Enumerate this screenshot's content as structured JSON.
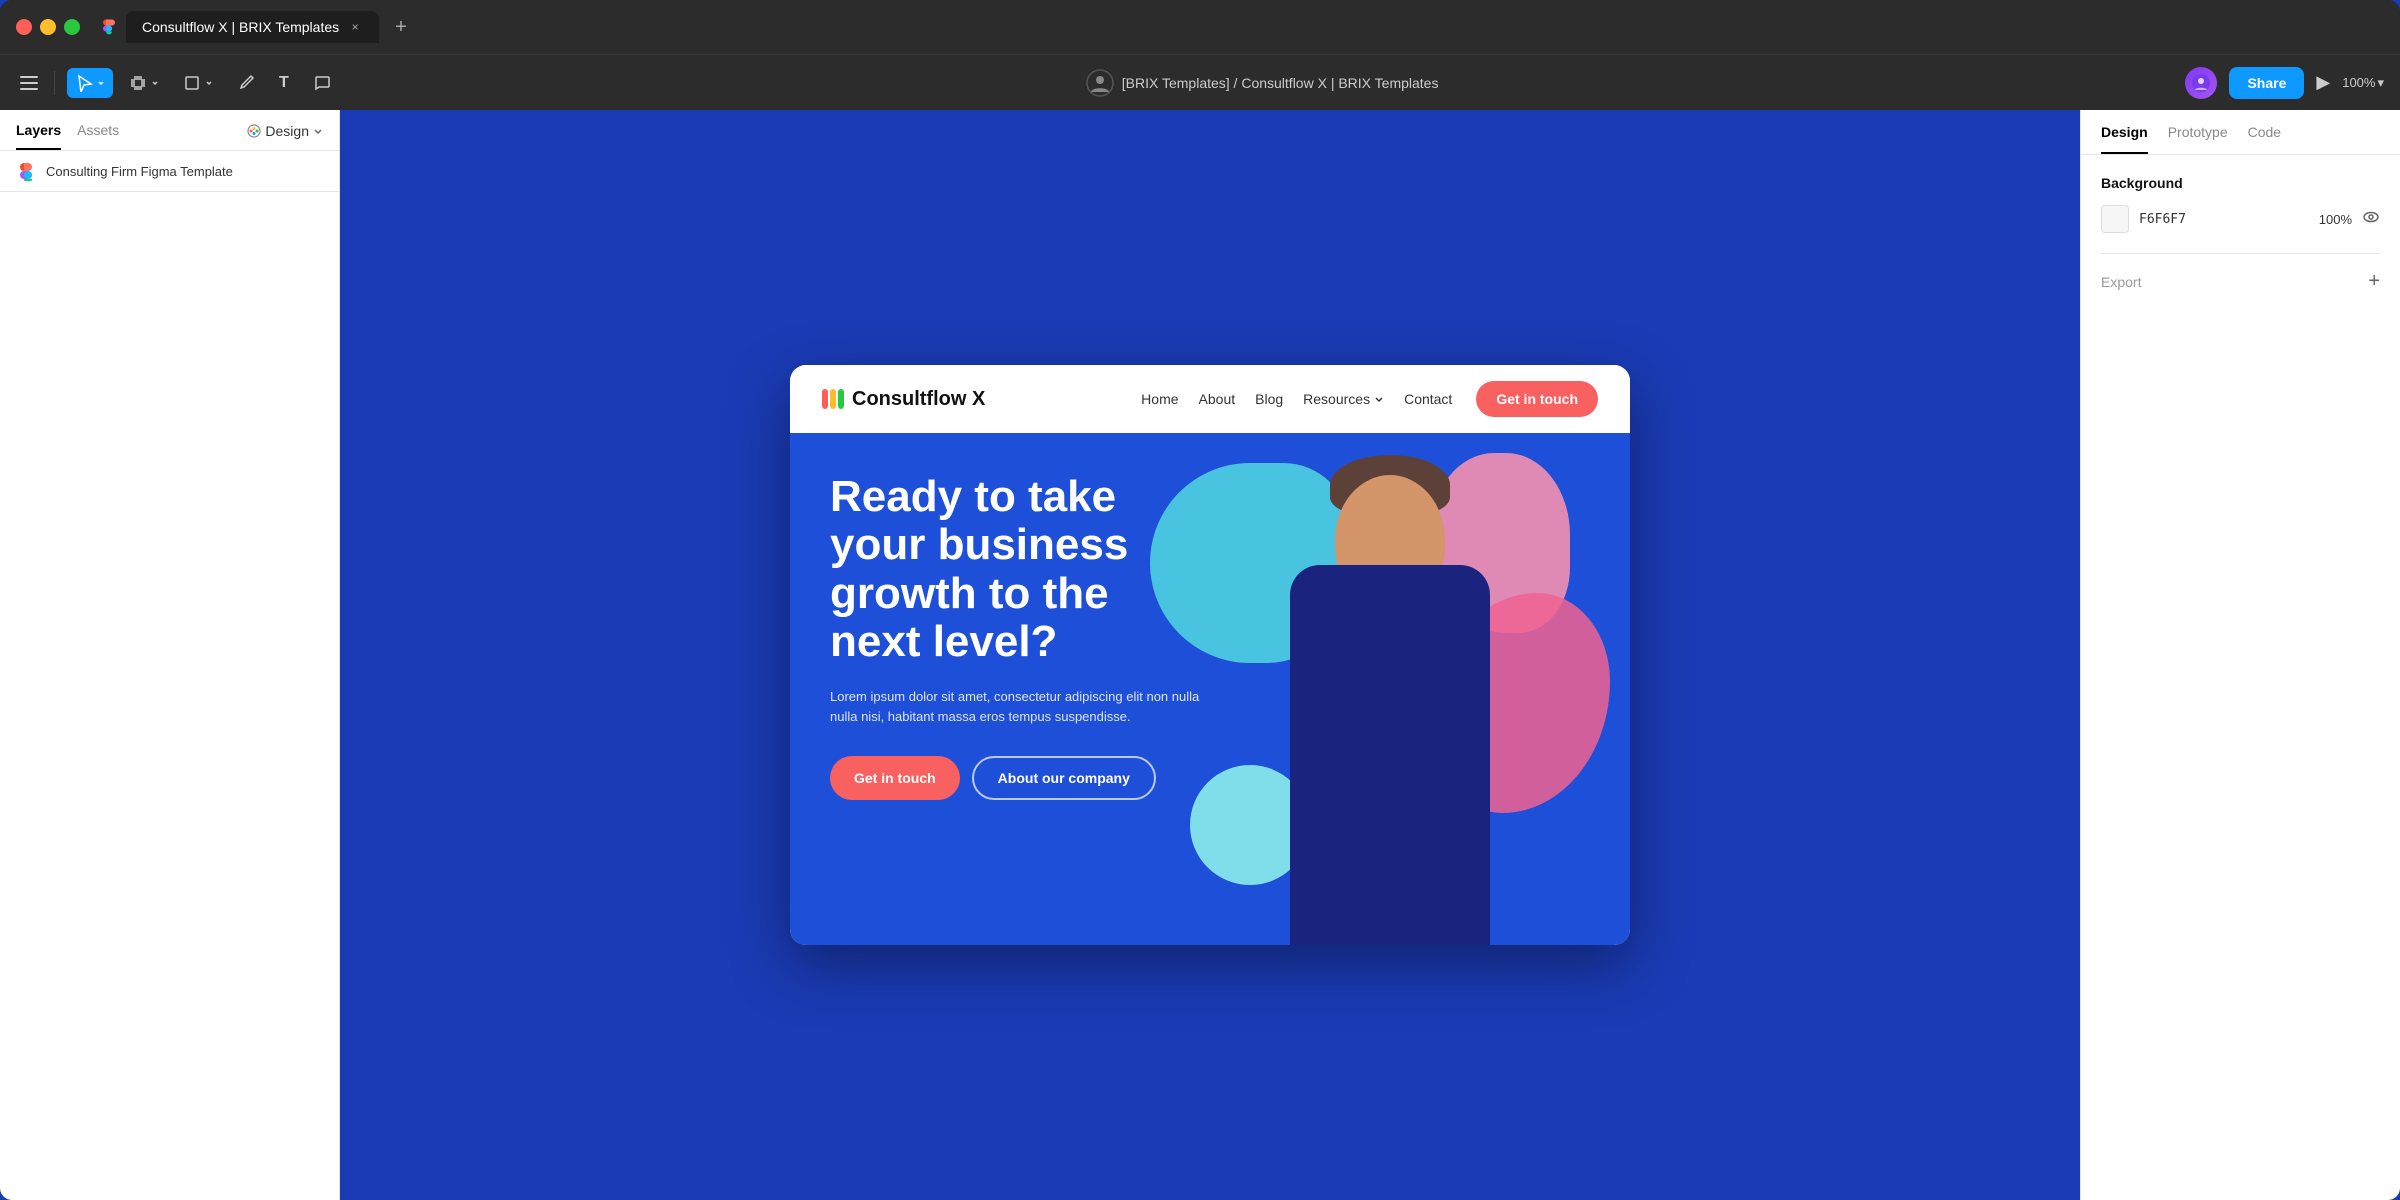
{
  "browser": {
    "tab_title": "Consultflow X | BRIX Templates",
    "tab_close": "×",
    "tab_new": "+",
    "window_controls": {
      "close": "close",
      "minimize": "minimize",
      "maximize": "maximize"
    }
  },
  "toolbar": {
    "hamburger": "menu",
    "select_tool": "select",
    "frame_tool": "frame",
    "shape_tool": "shape",
    "pen_tool": "pen",
    "text_tool": "T",
    "comment_tool": "comment",
    "breadcrumb": "[BRIX Templates] / Consultflow X | BRIX Templates",
    "share_label": "Share",
    "play_label": "▶",
    "zoom_label": "100%",
    "zoom_chevron": "▾"
  },
  "left_panel": {
    "tab_layers": "Layers",
    "tab_assets": "Assets",
    "design_label": "Design",
    "layer_item": {
      "icon": "figma",
      "label": "Consulting Firm Figma Template"
    }
  },
  "canvas": {
    "background_color": "#1a3bb5"
  },
  "website": {
    "nav": {
      "logo_text": "Consultflow X",
      "links": [
        "Home",
        "About",
        "Blog",
        "Resources",
        "Contact"
      ],
      "resources_has_dropdown": true,
      "cta_label": "Get in touch"
    },
    "hero": {
      "title": "Ready to take your business growth to the next level?",
      "description": "Lorem ipsum dolor sit amet, consectetur adipiscing elit non nulla nulla nisi, habitant massa eros tempus suspendisse.",
      "btn_primary": "Get in touch",
      "btn_secondary": "About our company",
      "background_color": "#1e4fd8"
    }
  },
  "right_panel": {
    "tabs": {
      "design": "Design",
      "prototype": "Prototype",
      "code": "Code"
    },
    "background_section": {
      "label": "Background",
      "color_hex": "F6F6F7",
      "opacity": "100%",
      "eye_icon": "👁"
    },
    "export_section": {
      "label": "Export",
      "add_icon": "+"
    }
  },
  "colors": {
    "brand_blue": "#1e4fd8",
    "coral_red": "#f96060",
    "teal": "#4dd0e1",
    "pink": "#f06292",
    "yellow": "#fdd835",
    "nav_bg": "#ffffff",
    "panel_bg": "#ffffff",
    "canvas_bg": "#1a3bb5"
  }
}
